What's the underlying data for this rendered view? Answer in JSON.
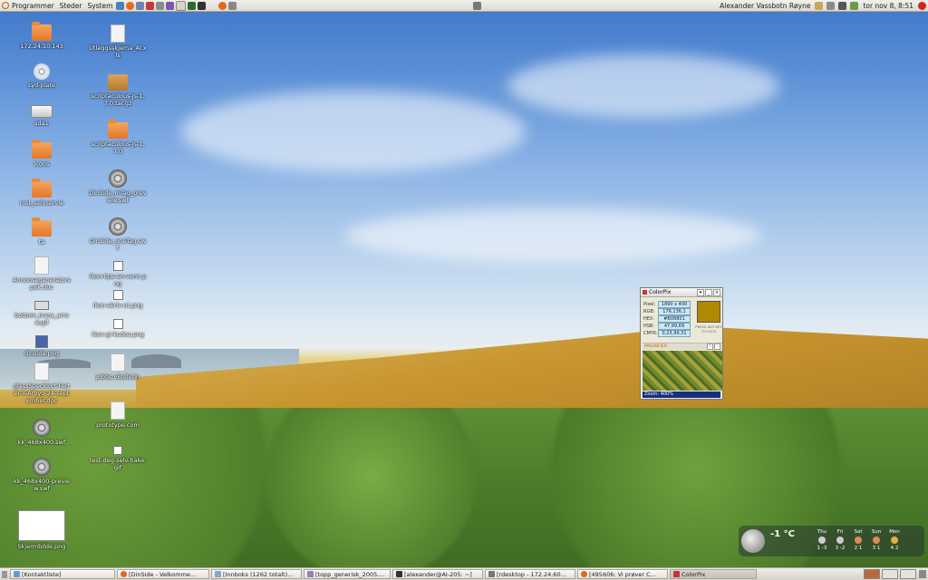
{
  "top_panel": {
    "menus": [
      "Programmer",
      "Steder",
      "System"
    ],
    "user_name": "Alexander Vassbotn Røyne",
    "datetime": "tor nov 8,  8:51"
  },
  "desktop_icons_col1": [
    {
      "label": "172.24.10.143",
      "type": "folder-remote"
    },
    {
      "label": "Lyd-plate",
      "type": "disc"
    },
    {
      "label": "sda1",
      "type": "drive"
    },
    {
      "label": "icons",
      "type": "folder"
    },
    {
      "label": "rost_selvservie",
      "type": "folder"
    },
    {
      "label": "ta",
      "type": "folder"
    },
    {
      "label": "Annonsegeneratorspek.doc",
      "type": "document"
    },
    {
      "label": "bottom_trans_arrow.gif",
      "type": "image"
    },
    {
      "label": "dinside.png",
      "type": "image"
    },
    {
      "label": "glassSpecklort-Ferter-il-Arbyg-24-september.doc",
      "type": "document"
    },
    {
      "label": "kk_468x400.swf",
      "type": "reel"
    },
    {
      "label": "kk_468x400-preview.swf",
      "type": "reel"
    },
    {
      "label": "Skjermbilde.png",
      "type": "thumbnail"
    }
  ],
  "desktop_icons_col2": [
    {
      "label": "Utleggsskjema_Al.xls",
      "type": "document"
    },
    {
      "label": "scriptaculous-js-1.7.0.tar.gz",
      "type": "package"
    },
    {
      "label": "scriptaculous-js-1.7.0",
      "type": "folder"
    },
    {
      "label": "DinSide_mTag_preview.swf",
      "type": "reel"
    },
    {
      "label": "DinSide_oneTag.swf",
      "type": "reel"
    },
    {
      "label": "ikon-tips-en-venn.png",
      "type": "image"
    },
    {
      "label": "ikon-skriv-ut.png",
      "type": "image"
    },
    {
      "label": "ikon-gi-kudos.png",
      "type": "image"
    },
    {
      "label": "jobbs.vBulletin",
      "type": "document"
    },
    {
      "label": "prototype.com",
      "type": "document"
    },
    {
      "label": "test-deg-selv-hake.gif",
      "type": "image"
    }
  ],
  "colorpix": {
    "title": "ColorPix",
    "rows": [
      {
        "key": "Pixel:",
        "value": "1890 x 400"
      },
      {
        "key": "RGB:",
        "value": "176,136,1"
      },
      {
        "key": "HEX:",
        "value": "#B08801"
      },
      {
        "key": "HSB:",
        "value": "47,99,69"
      },
      {
        "key": "CMYK:",
        "value": "0,23,99,31"
      }
    ],
    "swatch_color": "#B08801",
    "swatch_caption": "PRESS ANY KEY TO LOCK",
    "magnifier_label": "MAGNIFIER",
    "zoom": "Zoom: 400%"
  },
  "weather": {
    "temp": "-1 °C",
    "days": [
      {
        "day": "Thu",
        "temps": "1 -3"
      },
      {
        "day": "Fri",
        "temps": "3 -2"
      },
      {
        "day": "Sat",
        "temps": "2 1"
      },
      {
        "day": "Sun",
        "temps": "3 1"
      },
      {
        "day": "Mon",
        "temps": "4 2"
      }
    ]
  },
  "taskbar": {
    "tasks": [
      "[Kontaktliste]",
      "[DinSide - Velkomme...",
      "[Innboks (1262 totalt)...",
      "[topp_generisk_2005....",
      "[alexander@AI-205: ~]",
      "[rdesktop - 172.24.60...",
      "[495606: Vi prøver C...",
      "ColorPix"
    ]
  },
  "colors": {
    "panel_bg": "#dcdad3",
    "accent_orange": "#e4772a",
    "zoom_bar": "#15307e"
  }
}
